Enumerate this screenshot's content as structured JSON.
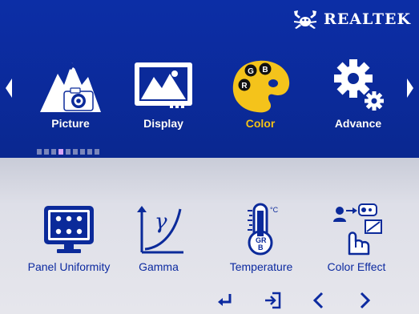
{
  "brand": {
    "text": "REALTEK",
    "logo_icon": "realtek-crab-logo-icon"
  },
  "colors": {
    "top_background": "#0b2a9a",
    "selected_label": "#f4c31b",
    "item_label": "#0c2aa0",
    "bottom_background": "#e3e3ea",
    "indicator_active": "#d8a4f6",
    "indicator_inactive": "#7a86bb"
  },
  "nav": {
    "left_icon": "chevron-left-icon",
    "right_icon": "chevron-right-icon"
  },
  "tabs": [
    {
      "label": "Picture",
      "icon": "mountain-camera-icon",
      "selected": false
    },
    {
      "label": "Display",
      "icon": "monitor-landscape-icon",
      "selected": false
    },
    {
      "label": "Color",
      "icon": "palette-rgb-icon",
      "selected": true
    },
    {
      "label": "Advance",
      "icon": "gears-icon",
      "selected": false
    }
  ],
  "page_indicator": {
    "count": 9,
    "active_index": 3
  },
  "items": [
    {
      "label": "Panel Uniformity",
      "icon": "panel-grid-icon"
    },
    {
      "label": "Gamma",
      "icon": "gamma-curve-icon"
    },
    {
      "label": "Temperature",
      "icon": "thermometer-rgb-icon"
    },
    {
      "label": "Color Effect",
      "icon": "hand-pointer-effect-icon"
    }
  ],
  "softkeys": [
    {
      "icon": "enter-icon"
    },
    {
      "icon": "exit-icon"
    },
    {
      "icon": "arrow-left-icon"
    },
    {
      "icon": "arrow-right-icon"
    }
  ]
}
